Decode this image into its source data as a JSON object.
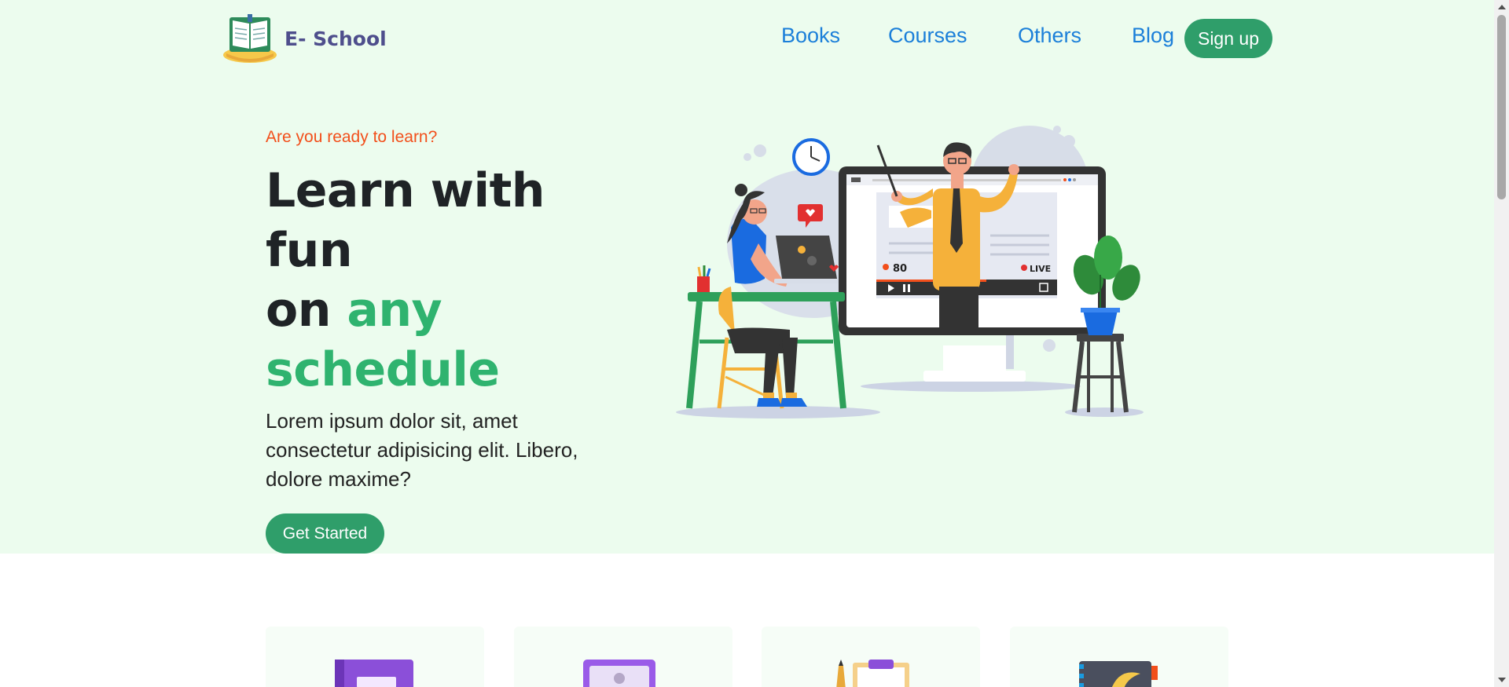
{
  "brand": {
    "name": "E- School",
    "logo_icon": "open-book-logo-icon"
  },
  "nav": {
    "items": [
      {
        "label": "Books"
      },
      {
        "label": "Courses"
      },
      {
        "label": "Others"
      },
      {
        "label": "Blog"
      }
    ],
    "signup_label": "Sign up"
  },
  "hero": {
    "eyebrow": "Are you ready to learn?",
    "headline_line1": "Learn with",
    "headline_line2": "fun",
    "headline_line3_plain": "on ",
    "headline_line3_highlight": "any",
    "headline_line4_highlight": "schedule",
    "lead": "Lorem ipsum dolor sit, amet consectetur adipisicing elit. Libero, dolore maxime?",
    "cta_label": "Get Started",
    "illustration": {
      "viewer_count": "80",
      "live_label": "LIVE"
    }
  },
  "features": {
    "cards": [
      {
        "icon": "purple-book-icon"
      },
      {
        "icon": "id-card-icon"
      },
      {
        "icon": "clipboard-pencil-icon"
      },
      {
        "icon": "notebook-icon"
      }
    ]
  },
  "colors": {
    "hero_bg": "#ecfcee",
    "accent_green": "#2f9e6a",
    "highlight_green": "#2fb36f",
    "nav_blue": "#1b7fd9",
    "eyebrow_orange": "#f24f1b",
    "brand_text": "#4e4e8c"
  }
}
